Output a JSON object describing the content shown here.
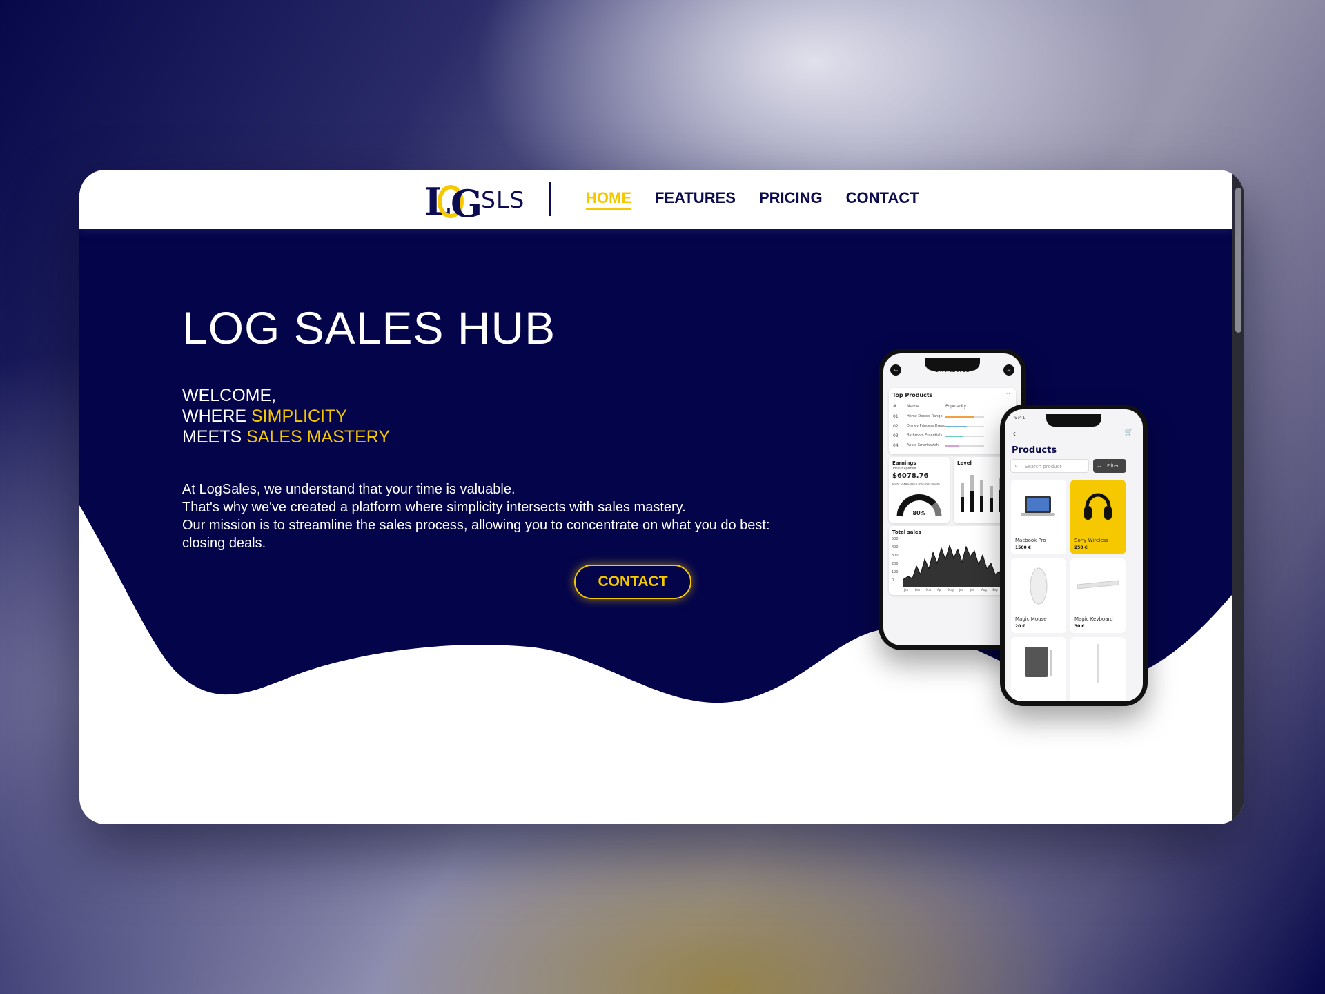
{
  "nav": {
    "logo_text": "SLS",
    "logo_mark": "LOG",
    "links": [
      "HOME",
      "FEATURES",
      "PRICING",
      "CONTACT"
    ],
    "active": "HOME"
  },
  "hero": {
    "title": "LOG SALES HUB",
    "tagline": {
      "line1": "WELCOME,",
      "line2_prefix": "WHERE ",
      "line2_highlight": "SIMPLICITY",
      "line3_prefix": "MEETS ",
      "line3_highlight": "SALES MASTERY"
    },
    "description": [
      "At LogSales, we understand that your time is valuable.",
      "That's why we've created a platform where simplicity intersects with sales mastery.",
      "Our mission is to streamline the sales process, allowing you to concentrate on what you do best: closing deals."
    ],
    "cta_label": "CONTACT"
  },
  "phone_stats": {
    "header": "STATISTICS",
    "top_products_title": "Top Products",
    "columns": [
      "#",
      "Name",
      "Popularity"
    ],
    "rows": [
      {
        "rank": "01",
        "name": "Home Decore Range",
        "popularity": 0.75
      },
      {
        "rank": "02",
        "name": "Disney Princess Dress",
        "popularity": 0.55
      },
      {
        "rank": "03",
        "name": "Bathroom Essentials",
        "popularity": 0.45
      },
      {
        "rank": "04",
        "name": "Apple Smartwatch",
        "popularity": 0.35
      }
    ],
    "earnings_title": "Earnings",
    "earnings_sub": "Total Expense",
    "earnings_value": "$6078.76",
    "earnings_note": "Profit is 48% More than last Month",
    "gauge_value": "80%",
    "level_title": "Level",
    "total_sales_title": "Total sales",
    "sales_yaxis": [
      "500",
      "400",
      "300",
      "200",
      "100",
      "0"
    ],
    "sales_xaxis": [
      "Jan",
      "Feb",
      "Mar",
      "Apr",
      "May",
      "Jun",
      "Jul",
      "Aug",
      "Sep",
      "Oct"
    ]
  },
  "phone_products": {
    "time": "9:41",
    "title": "Products",
    "search_placeholder": "Search product",
    "filter_label": "Filter",
    "items": [
      {
        "name": "Macbook Pro",
        "price": "1500 €"
      },
      {
        "name": "Sony Wireless",
        "price": "250 €"
      },
      {
        "name": "Magic Mouse",
        "price": "20 €"
      },
      {
        "name": "Magic Keyboard",
        "price": "30 €"
      }
    ]
  },
  "colors": {
    "navy": "#04044a",
    "accent": "#f5c800",
    "white": "#ffffff"
  }
}
